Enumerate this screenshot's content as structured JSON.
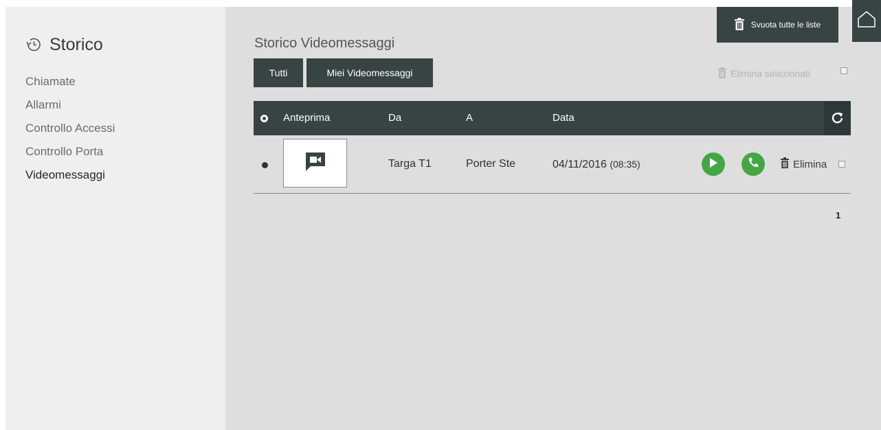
{
  "sidebar": {
    "title": "Storico",
    "items": [
      {
        "label": "Chiamate"
      },
      {
        "label": "Allarmi"
      },
      {
        "label": "Controllo Accessi"
      },
      {
        "label": "Controllo Porta"
      },
      {
        "label": "Videomessaggi",
        "active": true
      }
    ]
  },
  "main": {
    "title": "Storico Videomessaggi",
    "filters": {
      "all": "Tutti",
      "mine": "Miei Videomessaggi"
    },
    "clear_all": "Svuota tutte le liste",
    "delete_selected": "Elimina selezionati",
    "table": {
      "columns": {
        "preview": "Anteprima",
        "from": "Da",
        "to": "A",
        "date": "Data"
      },
      "rows": [
        {
          "from": "Targa T1",
          "to": "Porter Ste",
          "date": "04/11/2016",
          "time": "(08:35)",
          "delete": "Elimina"
        }
      ]
    },
    "pagination": {
      "current": "1"
    }
  },
  "colors": {
    "header_bg": "#384343",
    "action_green": "#46a645",
    "main_bg": "#dedede",
    "sidebar_bg": "#efefef"
  },
  "icons": [
    "history-icon",
    "trash-icon",
    "home-icon",
    "refresh-icon",
    "video-message-icon",
    "play-icon",
    "phone-icon"
  ]
}
